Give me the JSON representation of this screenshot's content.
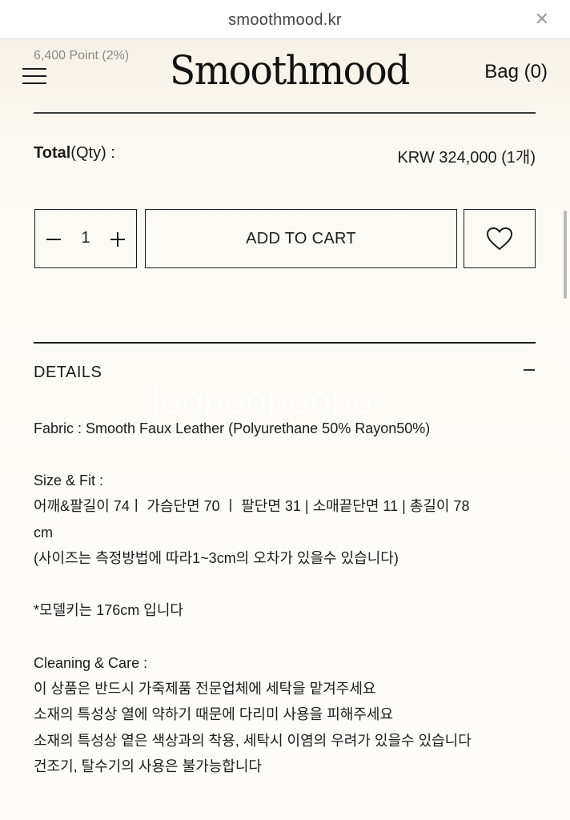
{
  "browser": {
    "url": "smoothmood.kr",
    "close_glyph": "✕"
  },
  "header": {
    "points": "6,400 Point (2%)",
    "logo": "Smoothmood",
    "bag": "Bag (0)"
  },
  "order": {
    "total_label_bold": "Total",
    "total_label_rest": "(Qty) :",
    "total_price": "KRW 324,000 (1개)",
    "quantity": "1",
    "add_to_cart": "ADD TO CART"
  },
  "details": {
    "title": "DETAILS",
    "watermark": "loopoopoopo",
    "fabric": "Fabric : Smooth Faux Leather (Polyurethane 50% Rayon50%)",
    "size_title": "Size & Fit :",
    "size_line1": "어깨&팔길이 74ㅣ 가슴단면 70 ㅣ 팔단면 31 | 소매끝단면 11 | 총길이 78",
    "size_line2": "cm",
    "size_note": "(사이즈는 측정방법에 따라1~3cm의 오차가 있을수 있습니다)",
    "model": "*모델키는 176cm 입니다",
    "care_title": "Cleaning & Care :",
    "care_lines": [
      "이 상품은 반드시 가죽제품 전문업체에 세탁을 맡겨주세요",
      "소재의 특성상 열에 약하기 때문에 다리미 사용을 피해주세요",
      "소재의 특성상 옅은 색상과의 착용, 세탁시 이염의 우려가 있을수 있습니다",
      "건조기, 탈수기의 사용은 불가능합니다"
    ]
  },
  "icons": {
    "menu": "menu-icon",
    "heart": "heart-icon",
    "minus": "minus-icon",
    "plus": "plus-icon",
    "close": "close-icon"
  },
  "colors": {
    "background": "#f9f5ec",
    "text": "#1c1c1c",
    "muted": "#8a8a8a"
  }
}
